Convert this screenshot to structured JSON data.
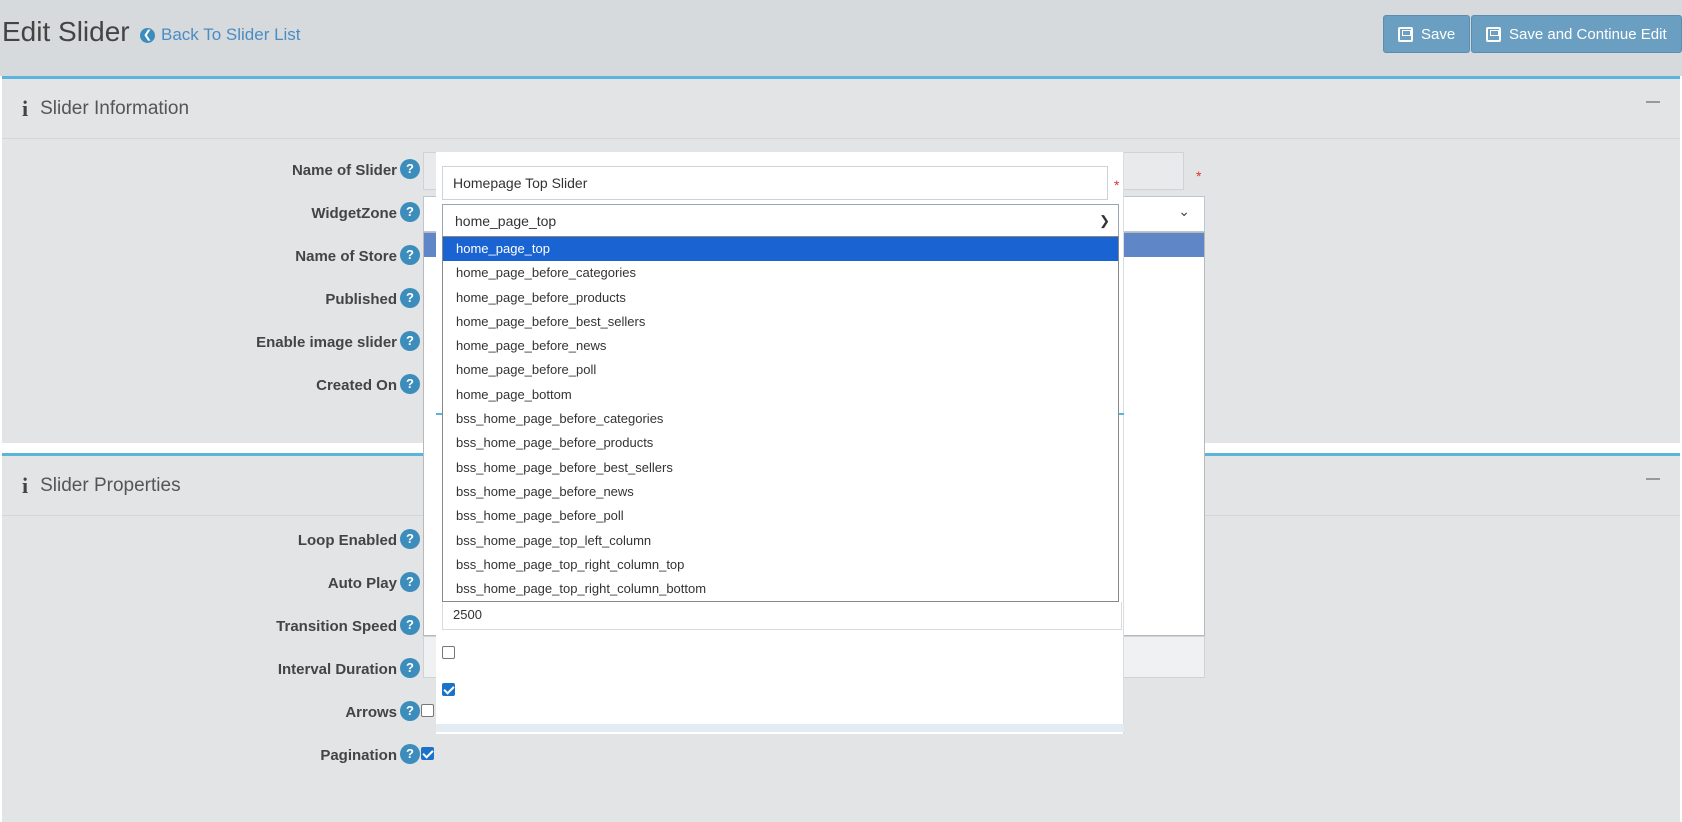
{
  "header": {
    "title": "Edit Slider",
    "back_link": "Back To Slider List",
    "save_label": "Save",
    "save_continue_label": "Save and Continue Edit"
  },
  "panels": {
    "info_title": "Slider Information",
    "props_title": "Slider Properties"
  },
  "info_fields": [
    {
      "label": "Name of Slider"
    },
    {
      "label": "WidgetZone"
    },
    {
      "label": "Name of Store"
    },
    {
      "label": "Published"
    },
    {
      "label": "Enable image slider"
    },
    {
      "label": "Created On"
    }
  ],
  "props_fields": [
    {
      "label": "Loop Enabled"
    },
    {
      "label": "Auto Play"
    },
    {
      "label": "Transition Speed"
    },
    {
      "label": "Interval Duration"
    },
    {
      "label": "Arrows"
    },
    {
      "label": "Pagination"
    }
  ],
  "help_glyph": "?",
  "required_mark": "*",
  "form": {
    "name_value": "Homepage Top Slider",
    "widget_zone_selected": "home_page_top",
    "transition_speed_value": "2500",
    "arrows_checked": false,
    "pagination_checked": true
  },
  "widget_zone_options": [
    "home_page_top",
    "home_page_before_categories",
    "home_page_before_products",
    "home_page_before_best_sellers",
    "home_page_before_news",
    "home_page_before_poll",
    "home_page_bottom",
    "bss_home_page_before_categories",
    "bss_home_page_before_products",
    "bss_home_page_before_best_sellers",
    "bss_home_page_before_news",
    "bss_home_page_before_poll",
    "bss_home_page_top_left_column",
    "bss_home_page_top_right_column_top",
    "bss_home_page_top_right_column_bottom"
  ],
  "colors": {
    "accent": "#3c8dbc",
    "panel_border": "#5bb4dc",
    "selected_option": "#1a63d3",
    "button": "#6a9fc2"
  }
}
